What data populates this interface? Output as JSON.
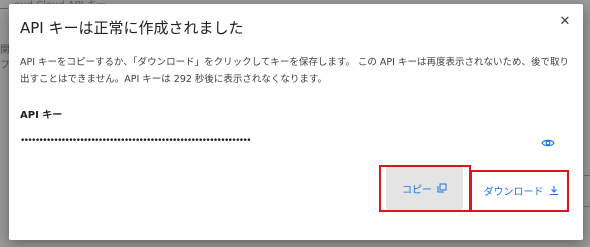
{
  "background": {
    "window_title": "oud Cloud API キー",
    "left_fragments": [
      "関",
      "フ"
    ]
  },
  "dialog": {
    "title": "API キーは正常に作成されました",
    "description": "API キーをコピーするか、「ダウンロード」をクリックしてキーを保存します。 この API キーは再度表示されないため、後で取り出すことはできません。API キーは 292 秒後に表示されなくなります。",
    "api_key_label": "API キー",
    "api_key_value": "••••••••••••••••••••••••••••••••••••••••••••••••••••••••••••••",
    "visibility_icon": "eye-icon",
    "close_icon": "close-icon",
    "copy_label": "コピー",
    "copy_icon": "copy-icon",
    "download_label": "ダウンロード",
    "download_icon": "download-icon"
  },
  "colors": {
    "accent": "#1a73e8",
    "highlight": "#d11a1a"
  }
}
